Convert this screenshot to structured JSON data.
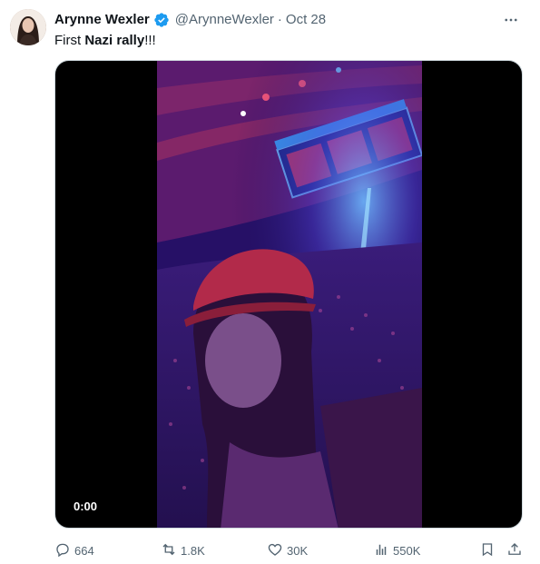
{
  "author": {
    "display_name": "Arynne Wexler",
    "handle": "@ArynneWexler",
    "separator": "·",
    "date": "Oct 28",
    "verified": true
  },
  "tweet": {
    "text_prefix": "First ",
    "text_bold": "Nazi rally",
    "text_suffix": "!!!"
  },
  "media": {
    "type": "video",
    "timestamp": "0:00"
  },
  "actions": {
    "replies": "664",
    "reposts": "1.8K",
    "likes": "30K",
    "views": "550K"
  },
  "colors": {
    "verified_blue": "#1d9bf0",
    "icon_gray": "#536471"
  }
}
